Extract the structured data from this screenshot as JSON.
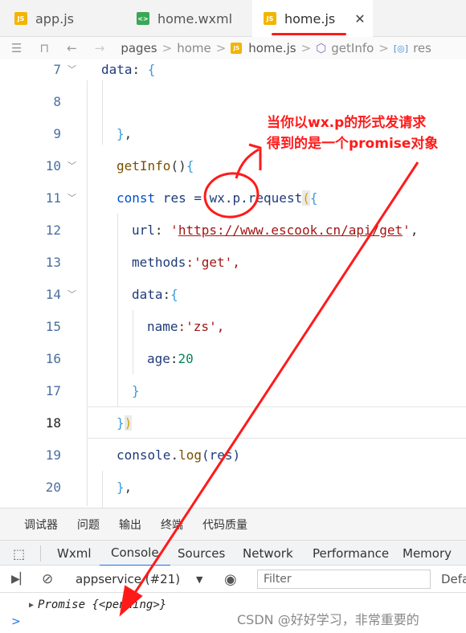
{
  "tabs": [
    {
      "label": "app.js",
      "icon": "js-file-icon"
    },
    {
      "label": "home.wxml",
      "icon": "wxml-file-icon"
    },
    {
      "label": "home.js",
      "icon": "js-file-icon",
      "active": true
    }
  ],
  "tab_close": "✕",
  "breadcrumb": {
    "nav_menu": "☰",
    "nav_bookmark": "⊓",
    "nav_back": "←",
    "nav_forward": "→",
    "items": [
      "pages",
      "home",
      "home.js",
      "getInfo",
      "res"
    ],
    "separator": ">"
  },
  "editor": {
    "lines": [
      {
        "n": "7"
      },
      {
        "n": "8"
      },
      {
        "n": "9"
      },
      {
        "n": "10"
      },
      {
        "n": "11"
      },
      {
        "n": "12"
      },
      {
        "n": "13"
      },
      {
        "n": "14"
      },
      {
        "n": "15"
      },
      {
        "n": "16"
      },
      {
        "n": "17"
      },
      {
        "n": "18"
      },
      {
        "n": "19"
      },
      {
        "n": "20"
      }
    ],
    "code": {
      "l7_key": "data",
      "l7_rest": ": ",
      "l7_brace": "{",
      "l9_close": "}",
      "l9_comma": ",",
      "l10_fn": "getInfo",
      "l10_paren": "()",
      "l10_brace": "{",
      "l11_kw": "const",
      "l11_var": " res = ",
      "l11_call": "wx.p.request",
      "l11_paren": "(",
      "l11_brace": "{",
      "l12_key": "url",
      "l12_colon": ": ",
      "l12_q1": "'",
      "l12_url": "https://www.escook.cn/api/get",
      "l12_q2": "'",
      "l12_comma": ",",
      "l13_key": "methods",
      "l13_val": ":'get',",
      "l14_key": "data",
      "l14_colon": ":",
      "l14_brace": "{",
      "l15_key": "name",
      "l15_val": ":'zs',",
      "l16_key": "age",
      "l16_colon": ":",
      "l16_num": "20",
      "l17_brace": "}",
      "l18_brace": "}",
      "l18_paren": ")",
      "l19_obj": "console",
      "l19_dot": ".",
      "l19_fn": "log",
      "l19_arg": "(res)",
      "l20_brace": "}",
      "l20_comma": ","
    }
  },
  "annotation": {
    "line1": "当你以wx.p的形式发请求",
    "line2": "得到的是一个promise对象",
    "color": "#ff1a1a"
  },
  "panel_tabs": [
    "调试器",
    "问题",
    "输出",
    "终端",
    "代码质量"
  ],
  "devtools_tabs": [
    "Wxml",
    "Console",
    "Sources",
    "Network",
    "Performance",
    "Memory"
  ],
  "toolbar": {
    "context": "appservice (#21)",
    "filter_placeholder": "Filter",
    "levels": "Defa"
  },
  "console": {
    "output": "Promise {<pending>}",
    "prompt": ">"
  },
  "watermark": "CSDN @好好学习，非常重要的"
}
